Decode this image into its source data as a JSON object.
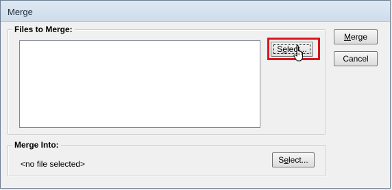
{
  "window": {
    "title": "Merge"
  },
  "files_group": {
    "legend": "Files to Merge:",
    "files": [],
    "select_label_pre": "S",
    "select_label_ul": "e",
    "select_label_post": "lect..."
  },
  "into_group": {
    "legend": "Merge Into:",
    "value": "<no file selected>",
    "select_label_pre": "S",
    "select_label_ul": "e",
    "select_label_post": "lect..."
  },
  "buttons": {
    "merge_pre": "",
    "merge_ul": "M",
    "merge_post": "erge",
    "cancel": "Cancel"
  },
  "colors": {
    "highlight": "#d9141b"
  },
  "icons": {
    "cursor": "hand-pointer-icon"
  }
}
